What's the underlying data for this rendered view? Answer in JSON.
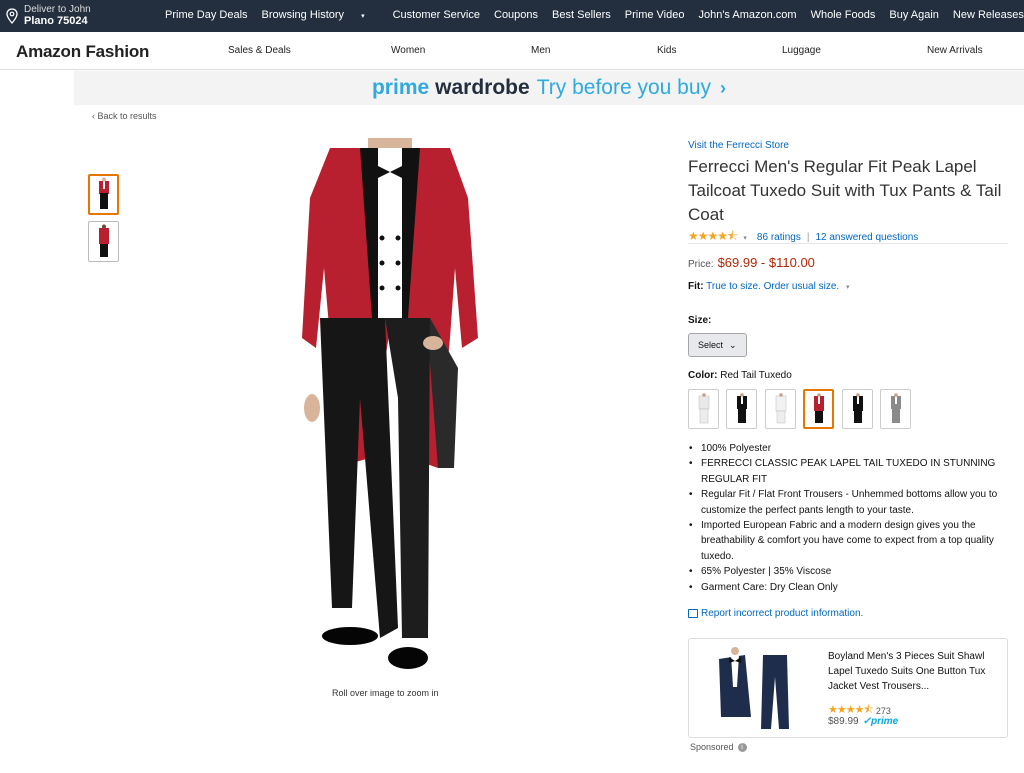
{
  "nav": {
    "deliver_line1": "Deliver to John",
    "deliver_line2": "Plano 75024",
    "links": [
      "Prime Day Deals",
      "Browsing History",
      "Customer Service",
      "Coupons",
      "Best Sellers",
      "Prime Video",
      "John's Amazon.com",
      "Whole Foods",
      "Buy Again",
      "New Releases"
    ],
    "browsing_caret": "▾"
  },
  "subnav": {
    "brand": "Amazon Fashion",
    "categories": [
      "Sales & Deals",
      "Women",
      "Men",
      "Kids",
      "Luggage",
      "New Arrivals"
    ]
  },
  "banner": {
    "word1": "prime",
    "word2": "wardrobe",
    "tagline": "Try before you buy",
    "chevron": "›"
  },
  "back_link": "‹ Back to results",
  "zoom_hint": "Roll over image to zoom in",
  "product": {
    "store_link": "Visit the Ferrecci Store",
    "title": "Ferrecci Men's Regular Fit Peak Lapel Tailcoat Tuxedo Suit with Tux Pants & Tail Coat",
    "stars": 4.5,
    "stars_display": "★★★★⯪",
    "rating_dropdown": "▾",
    "ratings_count": "86 ratings",
    "separator": "|",
    "answered": "12 answered questions",
    "price_label": "Price:",
    "price": "$69.99 - $110.00",
    "fit_label": "Fit:",
    "fit_value": "True to size. Order usual size.",
    "fit_dropdown": "▾",
    "size_label": "Size:",
    "size_select": "Select",
    "size_chevron": "⌄",
    "color_label": "Color:",
    "color_value": "Red Tail Tuxedo",
    "swatches": [
      {
        "name": "white-suit",
        "selected": false
      },
      {
        "name": "black-suit",
        "selected": false
      },
      {
        "name": "white-tail",
        "selected": false
      },
      {
        "name": "red-tail",
        "selected": true
      },
      {
        "name": "black-tail",
        "selected": false
      },
      {
        "name": "grey-suit",
        "selected": false
      }
    ],
    "bullets": [
      "100% Polyester",
      "FERRECCI CLASSIC PEAK LAPEL TAIL TUXEDO IN STUNNING REGULAR FIT",
      "Regular Fit / Flat Front Trousers - Unhemmed bottoms allow you to customize the perfect pants length to your taste.",
      "Imported European Fabric and a modern design gives you the breathability & comfort you have come to expect from a top quality tuxedo.",
      "65% Polyester | 35% Viscose",
      "Garment Care: Dry Clean Only"
    ],
    "report_link": "Report incorrect product information."
  },
  "ad": {
    "title": "Boyland Men's 3 Pieces Suit Shawl Lapel Tuxedo Suits One Button Tux Jacket Vest Trousers...",
    "stars_display": "★★★★⯪",
    "rating_count": "273",
    "price": "$89.99",
    "prime": "✓prime",
    "sponsored": "Sponsored",
    "info": "i"
  },
  "colors": {
    "nav_bg": "#232f3e",
    "link": "#0066c0",
    "price": "#b12704",
    "selected": "#e77600",
    "star": "#f4a41d",
    "prime_blue": "#2faadf"
  }
}
